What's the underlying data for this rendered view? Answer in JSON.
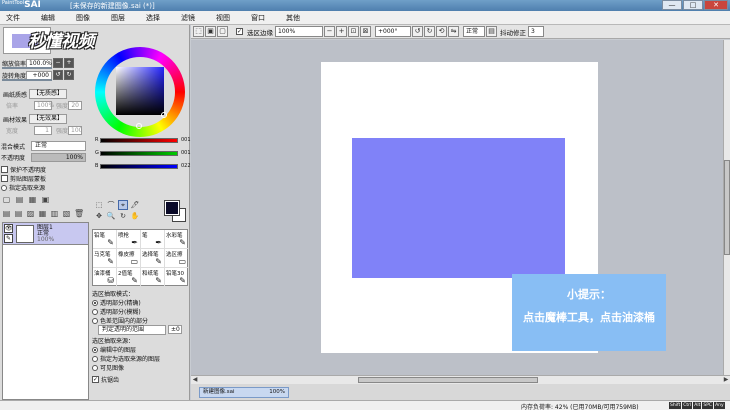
{
  "titlebar": {
    "logo": "SAI",
    "logo_small": "PaintTool",
    "title": "[未保存的新建图像.sai (*)]",
    "buttons": [
      "—",
      "□",
      "✕"
    ]
  },
  "watermark": "秒懂视频",
  "menu": [
    "文件",
    "编辑",
    "图像",
    "图层",
    "选择",
    "滤镜",
    "视图",
    "窗口",
    "其他"
  ],
  "navigator": {
    "zoom_label": "缩放倍率",
    "zoom_value": "100.0%",
    "rotate_label": "旋转角度",
    "rotate_value": "+000"
  },
  "texture": {
    "paper_label": "画纸质感",
    "paper_value": "【无质感】",
    "paper_sub1": "倍率",
    "paper_sub1_val": "100%",
    "paper_sub2": "强度",
    "paper_sub2_val": "20",
    "effect_label": "画材效果",
    "effect_value": "【无效果】",
    "effect_sub1": "宽度",
    "effect_sub1_val": "1",
    "effect_sub2": "强度",
    "effect_sub2_val": "100"
  },
  "layer_props": {
    "blend_label": "混合模式",
    "blend_value": "正常",
    "opacity_label": "不透明度",
    "opacity_value": "100%",
    "options": [
      "保护不透明度",
      "剪贴图层蒙板",
      "指定选取来源"
    ]
  },
  "color": {
    "r_label": "R",
    "r_value": "001",
    "g_label": "G",
    "g_value": "001",
    "b_label": "B",
    "b_value": "022",
    "fg": "#0a0a28",
    "bg": "#ffffff"
  },
  "tool_icons": [
    "⬚",
    "⌒",
    "⌖",
    "🖊",
    "✥",
    "🔍",
    "↻",
    "✋"
  ],
  "brushes": [
    {
      "name": "铅笔",
      "num": "",
      "icon": "✎"
    },
    {
      "name": "喷枪",
      "num": "",
      "icon": "✒"
    },
    {
      "name": "笔",
      "num": "",
      "icon": "✒"
    },
    {
      "name": "水彩笔",
      "num": "",
      "icon": "✎"
    },
    {
      "name": "马克笔",
      "num": "",
      "icon": "✎"
    },
    {
      "name": "橡皮擦",
      "num": "",
      "icon": "▭"
    },
    {
      "name": "选择笔",
      "num": "",
      "icon": "✎"
    },
    {
      "name": "选区擦",
      "num": "",
      "icon": "▭"
    },
    {
      "name": "油漆桶",
      "num": "",
      "icon": "⛁"
    },
    {
      "name": "2值笔",
      "num": "",
      "icon": "✎"
    },
    {
      "name": "和纸笔",
      "num": "",
      "icon": "✎"
    },
    {
      "name": "铅笔",
      "num": "30",
      "icon": "✎"
    }
  ],
  "layer_icons": [
    "▢",
    "▤",
    "▦",
    "▣"
  ],
  "layer_icons2": [
    "▤",
    "▤",
    "▨",
    "▦",
    "▥",
    "▧",
    "🗑"
  ],
  "layer": {
    "name": "图层1",
    "mode": "正常",
    "opacity": "100%"
  },
  "selection": {
    "mode_title": "选区抽取模式：",
    "modes": [
      "透明部分(精确)",
      "透明部分(模糊)",
      "色差范围内的部分"
    ],
    "mode_selected": 0,
    "range_label": "判定透明的范围",
    "range_value": "±0",
    "source_title": "选区抽取来源：",
    "sources": [
      "编辑中的图层",
      "指定为选取来源的图层",
      "可见图像"
    ],
    "source_selected": 0,
    "antialias": "抗锯齿"
  },
  "toolbar": {
    "selection_edge": "选区边缘",
    "zoom": "100%",
    "rotate": "+000°",
    "blend": "正常",
    "stabilizer_label": "抖动修正",
    "stabilizer_value": "3"
  },
  "canvas": {
    "paper_color": "#ffffff",
    "shape_color": "#8082f8"
  },
  "tip": {
    "title": "小提示：",
    "body": "点击魔棒工具，点击油漆桶"
  },
  "doc_tab": {
    "name": "新建图像.sai",
    "zoom": "100%"
  },
  "status": {
    "memory": "内存负荷率: 42% (已用70MB/可用759MB)",
    "keys": [
      "Shift",
      "Ctrl",
      "Alt",
      "SPC",
      "Any"
    ]
  }
}
